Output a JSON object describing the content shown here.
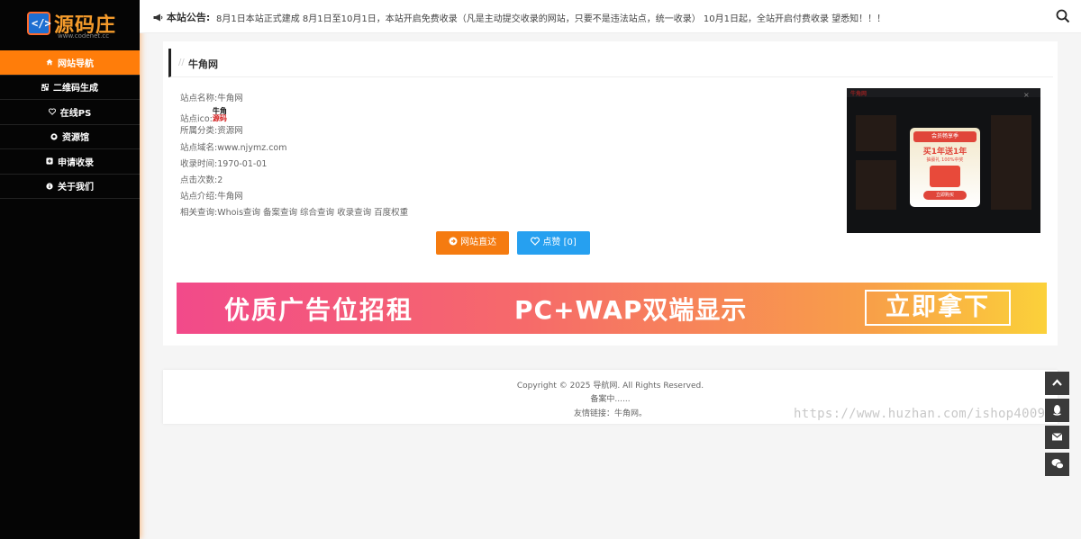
{
  "sidebar": {
    "logo_text": "源码庄",
    "logo_sub": "www.codenet.cc",
    "items": [
      {
        "label": "网站导航",
        "icon": "home-icon"
      },
      {
        "label": "二维码生成",
        "icon": "qrcode-icon"
      },
      {
        "label": "在线PS",
        "icon": "heart-icon"
      },
      {
        "label": "资源馆",
        "icon": "github-icon"
      },
      {
        "label": "申请收录",
        "icon": "plus-square-icon"
      },
      {
        "label": "关于我们",
        "icon": "info-circle-icon"
      }
    ]
  },
  "topbar": {
    "notice_label": "本站公告:",
    "notice_text": "8月1日本站正式建成 8月1日至10月1日，本站开启免费收录（凡是主动提交收录的网站，只要不是违法站点，统一收录） 10月1日起，全站开启付费收录 望悉知！！！"
  },
  "site": {
    "heading": "牛角网",
    "rows": {
      "name_k": "站点名称:",
      "name_v": "牛角网",
      "ico_k": "站点ico:",
      "ico_a": "牛角",
      "ico_b": "源码",
      "cat_k": "所属分类:",
      "cat_v": "资源网",
      "domain_k": "站点域名:",
      "domain_v": "www.njymz.com",
      "time_k": "收录时间:",
      "time_v": "1970-01-01",
      "clicks_k": "点击次数:",
      "clicks_v": "2",
      "intro_k": "站点介绍:",
      "intro_v": "牛角网",
      "query_k": "相关查询:",
      "queries": [
        "Whois查询",
        "备案查询",
        "综合查询",
        "收录查询",
        "百度权重"
      ]
    },
    "visit_label": "网站直达",
    "like_label": "点赞 [0]",
    "screenshot": {
      "brand": "牛角网",
      "popup_head": "会员畅享季",
      "popup_title": "买1年送1年",
      "popup_sub": "抽豪礼 100%中奖",
      "popup_button": "立即购买"
    }
  },
  "ad": {
    "left": "优质广告位招租",
    "middle": "PC+WAP双端显示",
    "right": "立即拿下"
  },
  "footer": {
    "copyright": "Copyright © 2025 导航网. All Rights Reserved.",
    "beian": "备案中......",
    "links": "友情链接：牛角网。"
  },
  "watermark": "https://www.huzhan.com/ishop4009",
  "colors": {
    "accent": "#ff7d0a",
    "like": "#26a0f0",
    "sidebar": "#050505"
  }
}
